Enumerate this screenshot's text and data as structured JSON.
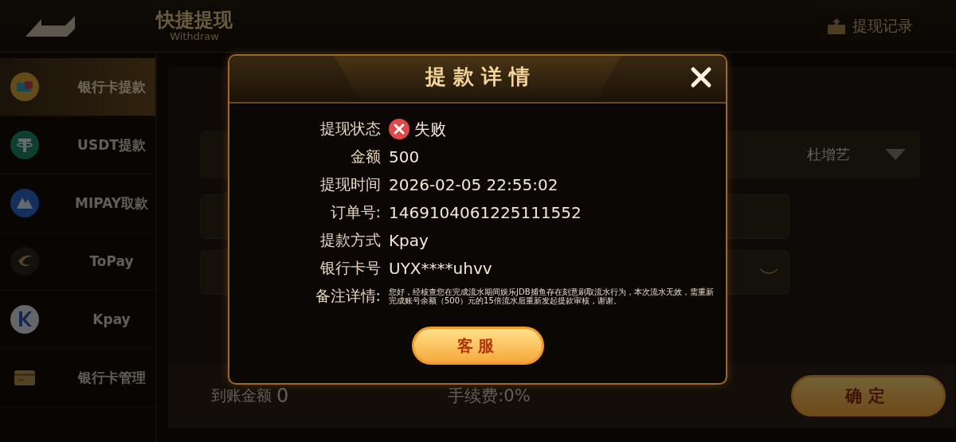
{
  "header": {
    "title": "快捷提现",
    "subtitle": "Withdraw",
    "record_link": "提现记录"
  },
  "sidebar": {
    "items": [
      {
        "label": "银行卡提款",
        "kind": "bank",
        "selected": true
      },
      {
        "label": "USDT提款",
        "kind": "usdt",
        "selected": false
      },
      {
        "label": "MIPAY取款",
        "kind": "mipay",
        "selected": false
      },
      {
        "label": "ToPay",
        "kind": "topay",
        "selected": false
      },
      {
        "label": "Kpay",
        "kind": "kpay",
        "selected": false
      },
      {
        "label": "银行卡管理",
        "kind": "card",
        "selected": false
      }
    ]
  },
  "form": {
    "select_value": "杜增艺"
  },
  "footer": {
    "received_label": "到账金额",
    "received_value": "0",
    "fee": "手续费:0%",
    "confirm_button": "确定"
  },
  "dialog": {
    "title": "提 款 详 情",
    "rows": [
      {
        "label": "提现状态",
        "value": "失败",
        "kind": "failed"
      },
      {
        "label": "金额",
        "value": "500",
        "kind": "text"
      },
      {
        "label": "提现时间",
        "value": "2026-02-05 22:55:02",
        "kind": "text"
      },
      {
        "label": "订单号:",
        "value": "1469104061225111552",
        "kind": "text"
      },
      {
        "label": "提款方式",
        "value": "Kpay",
        "kind": "text"
      },
      {
        "label": "银行卡号",
        "value": "UYX****uhvv",
        "kind": "text"
      }
    ],
    "note": {
      "label": "备注详情:",
      "text": "您好，经核查您在完成流水期间娱乐JDB捕鱼存在刻意刷取流水行为，本次流水无效，需重新完成账号余额（500）元的15倍流水后重新发起提款审核，谢谢。"
    },
    "service_button": "客服"
  }
}
